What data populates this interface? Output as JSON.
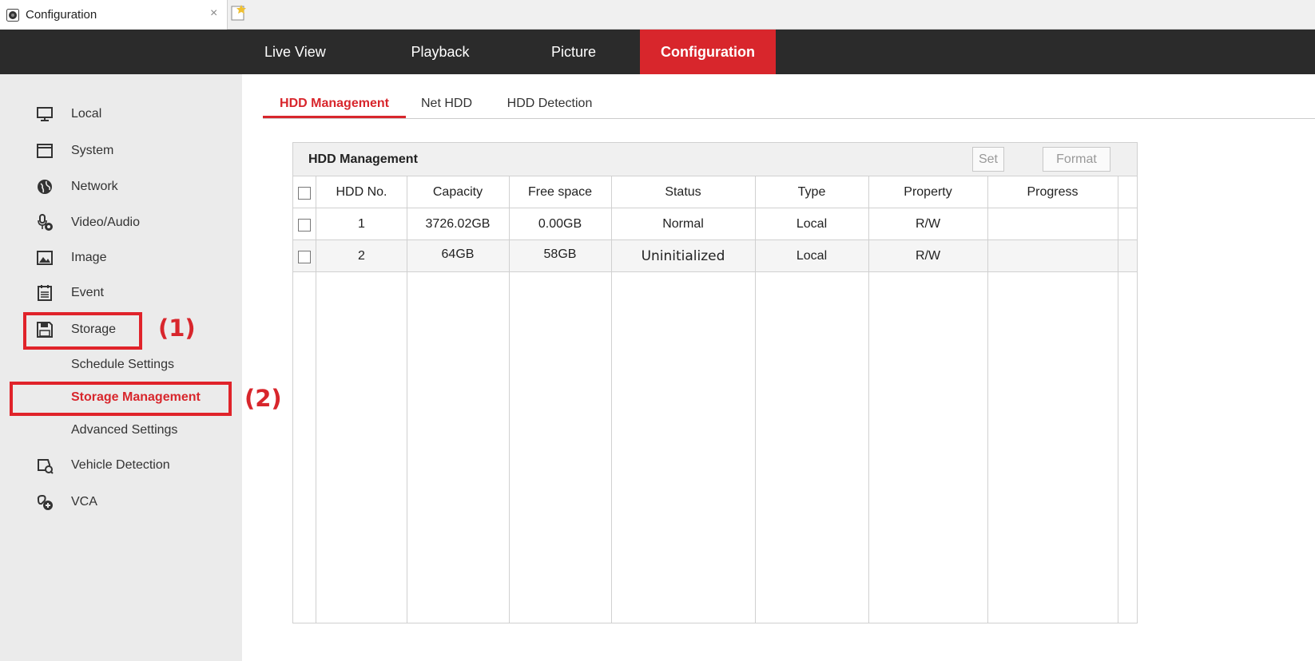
{
  "browser": {
    "tab_title": "Configuration",
    "close_glyph": "×",
    "tab_icon": "camera-lens-icon",
    "new_tab_icon": "new-tab-icon"
  },
  "topnav": {
    "items": [
      {
        "label": "Live View",
        "active": false
      },
      {
        "label": "Playback",
        "active": false
      },
      {
        "label": "Picture",
        "active": false
      },
      {
        "label": "Configuration",
        "active": true
      }
    ],
    "background": "#2b2b2b",
    "accent": "#d8262c"
  },
  "sidebar": {
    "items": [
      {
        "label": "Local",
        "icon": "monitor-icon"
      },
      {
        "label": "System",
        "icon": "window-icon"
      },
      {
        "label": "Network",
        "icon": "globe-icon"
      },
      {
        "label": "Video/Audio",
        "icon": "microphone-icon"
      },
      {
        "label": "Image",
        "icon": "image-icon"
      },
      {
        "label": "Event",
        "icon": "calendar-icon"
      },
      {
        "label": "Storage",
        "icon": "floppy-disk-icon",
        "expanded": true
      },
      {
        "label": "Vehicle Detection",
        "icon": "vehicle-search-icon"
      },
      {
        "label": "VCA",
        "icon": "vca-icon"
      }
    ],
    "storage_sub": [
      {
        "label": "Schedule Settings",
        "active": false
      },
      {
        "label": "Storage Management",
        "active": true
      },
      {
        "label": "Advanced Settings",
        "active": false
      }
    ]
  },
  "annotations": {
    "step1": "(1)",
    "step2": "(2)",
    "color": "#e0232a"
  },
  "subtabs": [
    {
      "label": "HDD Management",
      "active": true
    },
    {
      "label": "Net HDD",
      "active": false
    },
    {
      "label": "HDD Detection",
      "active": false
    }
  ],
  "panel": {
    "title": "HDD Management",
    "set_label": "Set",
    "format_label": "Format"
  },
  "table": {
    "columns": [
      "HDD No.",
      "Capacity",
      "Free space",
      "Status",
      "Type",
      "Property",
      "Progress"
    ],
    "rows": [
      {
        "hdd_no": "1",
        "capacity": "3726.02GB",
        "free_space": "0.00GB",
        "status": "Normal",
        "type": "Local",
        "property": "R/W",
        "progress": ""
      },
      {
        "hdd_no": "2",
        "capacity": "64GB",
        "free_space": "58GB",
        "status": "Uninitialized",
        "type": "Local",
        "property": "R/W",
        "progress": ""
      }
    ]
  }
}
